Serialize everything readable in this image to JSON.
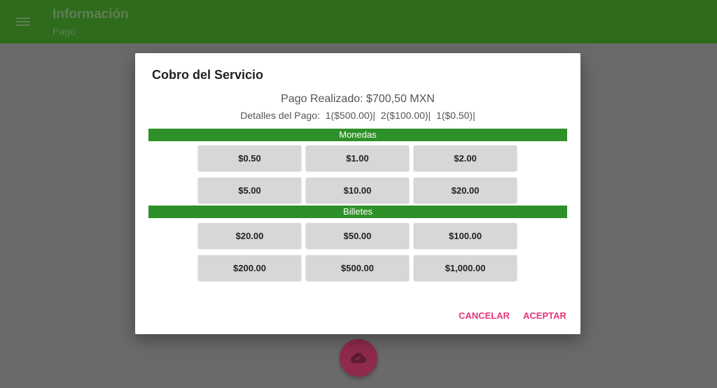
{
  "appbar": {
    "title": "Información",
    "subtitle": "Pago"
  },
  "dialog": {
    "title": "Cobro del Servicio",
    "total": "Pago Realizado: $700,50 MXN",
    "details": "Detalles del Pago:  1($500.00)|  2($100.00)|  1($0.50)|",
    "sections": {
      "coins": {
        "label": "Monedas",
        "buttons": [
          "$0.50",
          "$1.00",
          "$2.00",
          "$5.00",
          "$10.00",
          "$20.00"
        ]
      },
      "bills": {
        "label": "Billetes",
        "buttons": [
          "$20.00",
          "$50.00",
          "$100.00",
          "$200.00",
          "$500.00",
          "$1,000.00"
        ]
      }
    },
    "actions": {
      "cancel": "CANCELAR",
      "accept": "ACEPTAR"
    }
  },
  "colors": {
    "appbar": "#2e6b1c",
    "section_bar": "#2e9028",
    "accent": "#e5367a",
    "fab": "#8f2a4c"
  },
  "icons": {
    "menu": "hamburger-menu-icon",
    "fab": "cloud-done-icon"
  }
}
